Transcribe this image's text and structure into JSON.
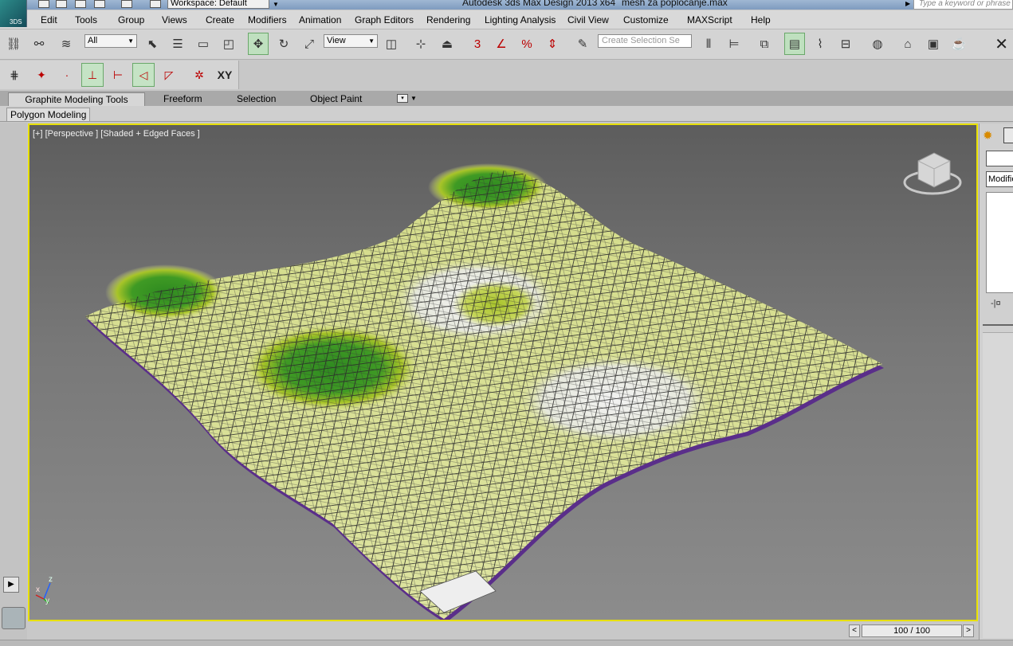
{
  "title_bar": {
    "app_title": "Autodesk 3ds Max Design 2013 x64",
    "file_name": "mesh za poplocanje.max",
    "workspace": "Workspace: Default",
    "search_placeholder": "Type a keyword or phrase",
    "logo_text": "3DS"
  },
  "menu": {
    "items": [
      "Edit",
      "Tools",
      "Group",
      "Views",
      "Create",
      "Modifiers",
      "Animation",
      "Graph Editors",
      "Rendering",
      "Lighting Analysis",
      "Civil View",
      "Customize",
      "MAXScript",
      "Help"
    ]
  },
  "main_toolbar": {
    "selection_filter": "All",
    "reference_coord": "View",
    "named_selection_placeholder": "Create Selection Se",
    "close_label": "✕",
    "snap_label": "3"
  },
  "snaps_toolbar": {
    "xy_label": "XY"
  },
  "ribbon": {
    "tabs": [
      "Graphite Modeling Tools",
      "Freeform",
      "Selection",
      "Object Paint"
    ],
    "active_tab": "Graphite Modeling Tools",
    "panel_label": "Polygon Modeling"
  },
  "viewport": {
    "label": "[+] [Perspective ] [Shaded + Edged Faces ]",
    "axis_z": "z",
    "axis_x": "x",
    "axis_y": "y",
    "border_color": "#e8e000",
    "mesh_color": "#d9e08a",
    "mesh_green": "#2f8a20",
    "mesh_lime": "#a8c428",
    "mesh_white": "#eaeaea"
  },
  "time_slider": {
    "frame": "100 / 100",
    "prev": "<",
    "next": ">"
  },
  "command_panel": {
    "modifier_list": "Modifier List",
    "pin_glyph": "-|¤"
  }
}
